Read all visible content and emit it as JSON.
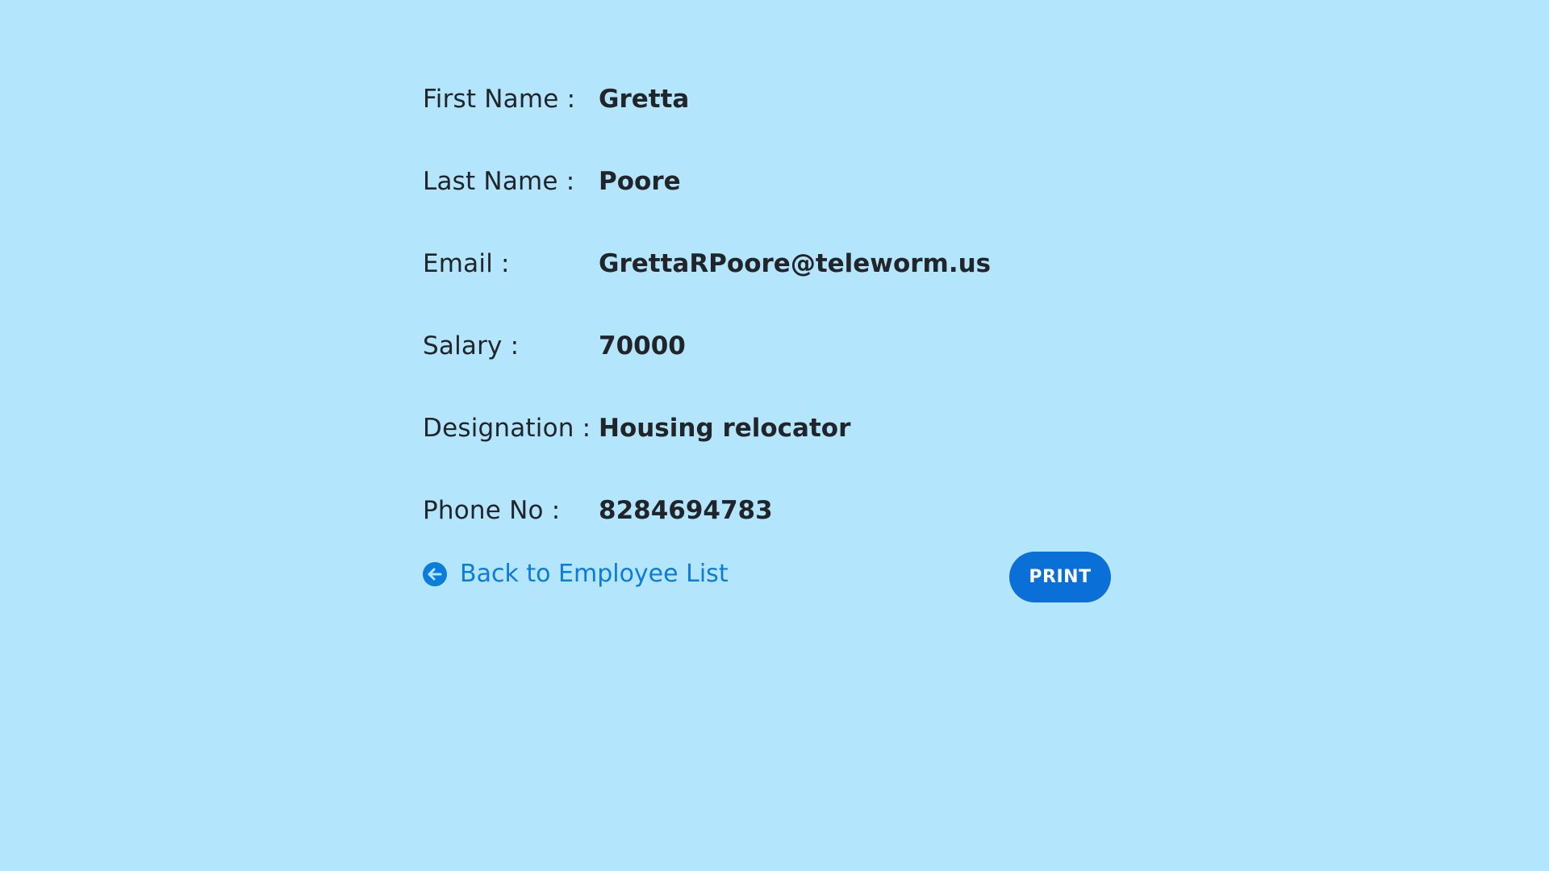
{
  "employee": {
    "fields": [
      {
        "label": "First Name :",
        "value": "Gretta"
      },
      {
        "label": "Last Name :",
        "value": "Poore"
      },
      {
        "label": "Email :",
        "value": "GrettaRPoore@teleworm.us"
      },
      {
        "label": "Salary :",
        "value": "70000"
      },
      {
        "label": "Designation :",
        "value": "Housing relocator"
      },
      {
        "label": "Phone No :",
        "value": "8284694783"
      }
    ]
  },
  "actions": {
    "back_label": "Back to Employee List",
    "back_icon": "arrow-left-circle-icon",
    "print_label": "PRINT"
  },
  "colors": {
    "background": "#b3e5fc",
    "text": "#212529",
    "link": "#0b7bdc",
    "button": "#0b6fd8"
  }
}
